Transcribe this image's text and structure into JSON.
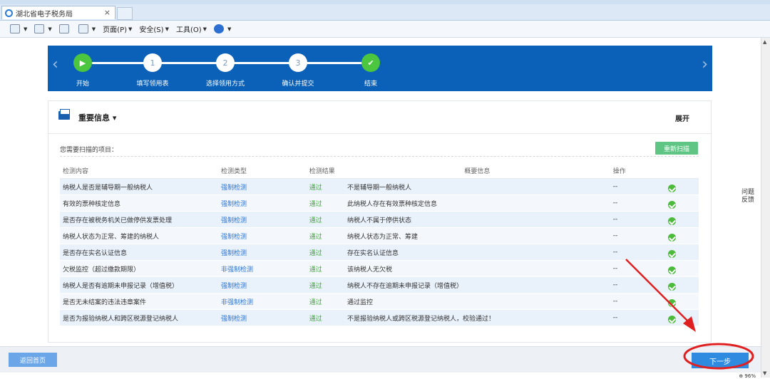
{
  "browser": {
    "tab_title": "湖北省电子税务局",
    "tab_close": "×",
    "commands": [
      {
        "label": "",
        "icon": "home-icon"
      },
      {
        "label": "",
        "icon": "feeds-icon"
      },
      {
        "label": "",
        "icon": "mail-icon"
      },
      {
        "label": "",
        "icon": "print-icon"
      },
      {
        "label": "页面(P)",
        "icon": ""
      },
      {
        "label": "安全(S)",
        "icon": ""
      },
      {
        "label": "工具(O)",
        "icon": ""
      },
      {
        "label": "",
        "icon": "help-icon"
      }
    ]
  },
  "stepper": {
    "steps": [
      {
        "label": "开始",
        "mark": "▶",
        "state": "start"
      },
      {
        "label": "填写领用表",
        "mark": "1",
        "state": "todo"
      },
      {
        "label": "选择领用方式",
        "mark": "2",
        "state": "todo"
      },
      {
        "label": "确认并提交",
        "mark": "3",
        "state": "todo"
      },
      {
        "label": "结束",
        "mark": "✔",
        "state": "done"
      }
    ],
    "prev_arrow": "‹",
    "next_arrow": "›"
  },
  "panel": {
    "title": "重要信息 ▾",
    "expand": "展开",
    "scan_label": "您需要扫描的项目：",
    "rescan": "重新扫描",
    "columns": [
      "检测内容",
      "检测类型",
      "检测结果",
      "概要信息",
      "操作"
    ],
    "rows": [
      {
        "content": "纳税人是否是辅导期一般纳税人",
        "type": "强制检测",
        "result": "通过",
        "summary": "不是辅导期一般纳税人",
        "op": "--"
      },
      {
        "content": "有效的票种核定信息",
        "type": "强制检测",
        "result": "通过",
        "summary": "此纳税人存在有效票种核定信息",
        "op": "--"
      },
      {
        "content": "是否存在被税务机关已做停供发票处理",
        "type": "强制检测",
        "result": "通过",
        "summary": "纳税人不属于停供状态",
        "op": "--"
      },
      {
        "content": "纳税人状态为正常、筹建的纳税人",
        "type": "强制检测",
        "result": "通过",
        "summary": "纳税人状态为正常、筹建",
        "op": "--"
      },
      {
        "content": "是否存在实名认证信息",
        "type": "强制检测",
        "result": "通过",
        "summary": "存在实名认证信息",
        "op": "--"
      },
      {
        "content": "欠税监控（超过缴款期限）",
        "type": "非强制检测",
        "result": "通过",
        "summary": "该纳税人无欠税",
        "op": "--"
      },
      {
        "content": "纳税人是否有逾期未申报记录（增值税）",
        "type": "强制检测",
        "result": "通过",
        "summary": "纳税人不存在逾期未申报记录（增值税）",
        "op": "--"
      },
      {
        "content": "是否无未结案的违法违章案件",
        "type": "非强制检测",
        "result": "通过",
        "summary": "通过监控",
        "op": "--"
      },
      {
        "content": "是否为报验纳税人和跨区税源登记纳税人",
        "type": "强制检测",
        "result": "通过",
        "summary": "不是报验纳税人或跨区税源登记纳税人，校验通过！",
        "op": "--"
      }
    ]
  },
  "bottom": {
    "back_home": "返回首页",
    "next": "下一步"
  },
  "side": {
    "feedback": "问题反馈"
  },
  "zoom": "⊕ 96%",
  "colors": {
    "stepper_bg": "#0b60b8",
    "pass_green": "#3eaa35",
    "link_blue": "#2a74d1",
    "rescan_green": "#5ec584",
    "next_blue": "#2f8be0",
    "annotation_red": "#e02020"
  }
}
